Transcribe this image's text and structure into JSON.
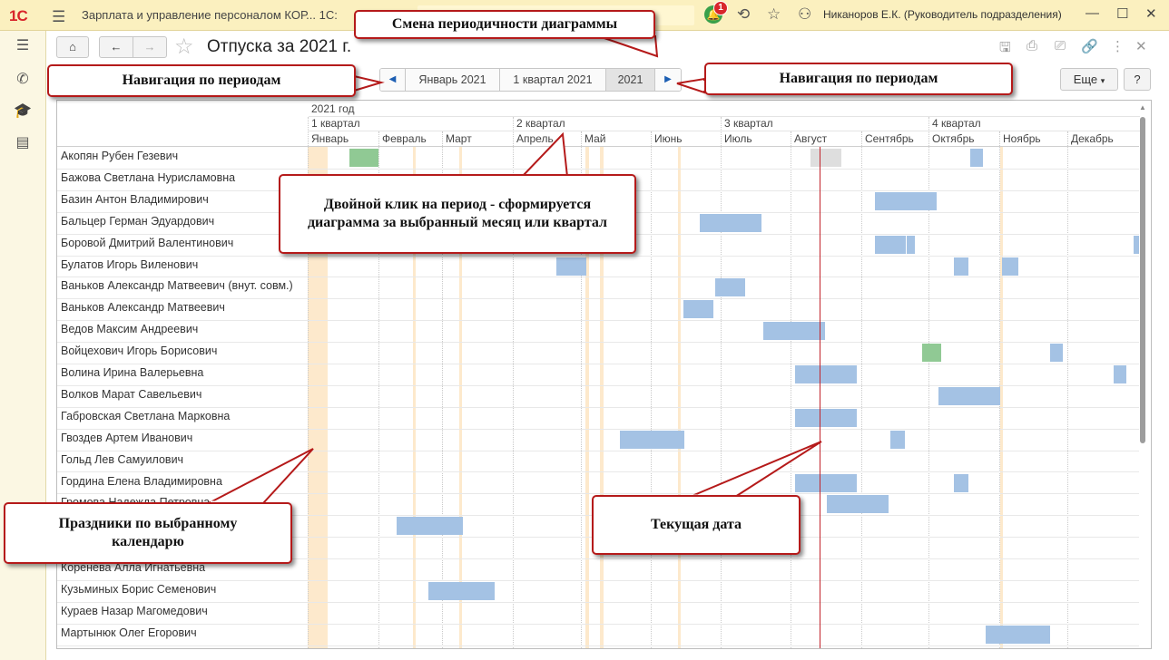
{
  "app": {
    "logo": "1С",
    "title": "Зарплата и управление персоналом КОР...",
    "title_suffix": "1С:",
    "notification_count": "1",
    "user": "Никаноров Е.К. (Руководитель подразделения)"
  },
  "toolbar": {
    "title": "Отпуска за 2021 г.",
    "periods": [
      "Январь 2021",
      "1 квартал 2021",
      "2021"
    ],
    "active_period": "2021",
    "more_label": "Еще",
    "help_label": "?"
  },
  "chart": {
    "year_label": "2021 год",
    "quarters": [
      "1 квартал",
      "2 квартал",
      "3 квартал",
      "4 квартал"
    ],
    "months": [
      "Январь",
      "Февраль",
      "Март",
      "Апрель",
      "Май",
      "Июнь",
      "Июль",
      "Август",
      "Сентябрь",
      "Октябрь",
      "Ноябрь",
      "Декабрь"
    ],
    "employees": [
      "Акопян Рубен Гезевич",
      "Бажова Светлана Нурисламовна",
      "Базин Антон Владимирович",
      "Бальцер Герман Эдуардович",
      "Боровой Дмитрий Валентинович",
      "Булатов Игорь Виленович",
      "Ваньков Александр Матвеевич (внут. совм.)",
      "Ваньков Александр Матвеевич",
      "Ведов Максим Андреевич",
      "Войцехович Игорь Борисович",
      "Волина Ирина Валерьевна",
      "Волков Марат Савельевич",
      "Габровская Светлана Марковна",
      "Гвоздев Артем Иванович",
      "Гольд Лев Самуилович",
      "Гордина Елена Владимировна",
      "Громова Надежда Петровна",
      "",
      "",
      "Коренева Алла Игнатьевна",
      "Кузьминых Борис Семенович",
      "Кураев Назар Магомедович",
      "Мартынюк Олег Егорович"
    ],
    "colors": {
      "vacation": "#a4c2e4",
      "approved": "#90c994",
      "planned": "#dedede",
      "holiday": "#fde9cc",
      "current_date": "#c2232b"
    }
  },
  "callouts": {
    "frequency": "Смена периодичности диаграммы",
    "nav_left": "Навигация по периодам",
    "nav_right": "Навигация по периодам",
    "doubleclick": "Двойной клик на период - сформируется диаграмма за выбранный месяц или квартал",
    "holidays": "Праздники по выбранному календарю",
    "current_date": "Текущая дата"
  }
}
